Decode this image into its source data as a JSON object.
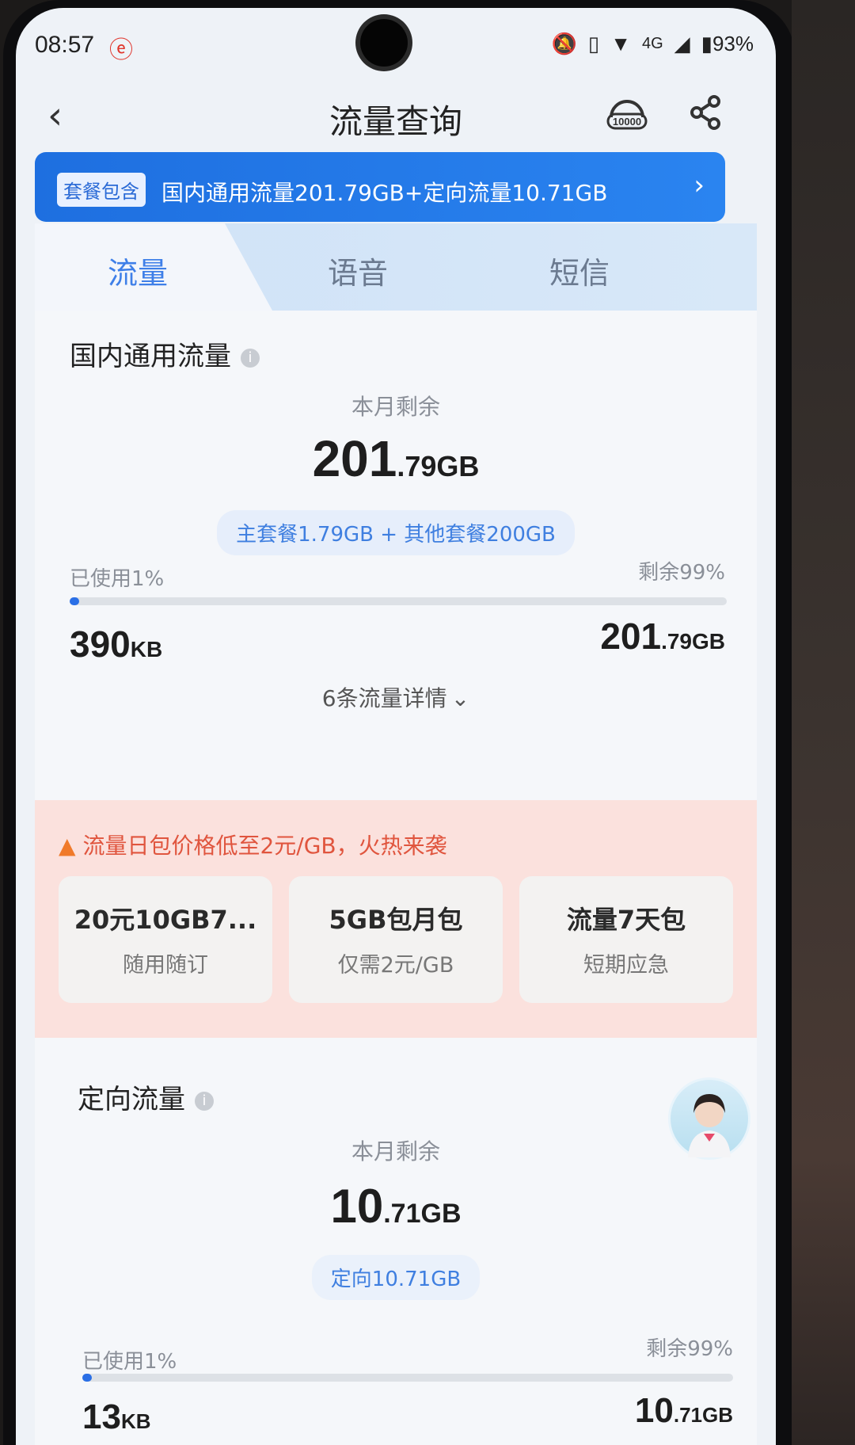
{
  "status_bar": {
    "time": "08:57",
    "network": "4G",
    "battery": "93%"
  },
  "header": {
    "title": "流量查询",
    "service_icon_text": "10000"
  },
  "banner": {
    "tag": "套餐包含",
    "text": "国内通用流量201.79GB+定向流量10.71GB"
  },
  "tabs": [
    {
      "label": "流量",
      "active": true
    },
    {
      "label": "语音",
      "active": false
    },
    {
      "label": "短信",
      "active": false
    }
  ],
  "domestic": {
    "title": "国内通用流量",
    "remaining_label": "本月剩余",
    "remaining_int": "201",
    "remaining_dec": ".79GB",
    "breakdown": "主套餐1.79GB + 其他套餐200GB",
    "used_label": "已使用1%",
    "left_label": "剩余99%",
    "used_fraction": 0.01,
    "used_value": "390",
    "used_unit": "KB",
    "left_int": "201",
    "left_dec": ".79GB",
    "details_link": "6条流量详情"
  },
  "promo": {
    "headline": "流量日包价格低至2元/GB，火热来袭",
    "items": [
      {
        "name": "20元10GB7...",
        "sub": "随用随订"
      },
      {
        "name": "5GB包月包",
        "sub": "仅需2元/GB"
      },
      {
        "name": "流量7天包",
        "sub": "短期应急"
      }
    ]
  },
  "directed": {
    "title": "定向流量",
    "remaining_label": "本月剩余",
    "remaining_int": "10",
    "remaining_dec": ".71GB",
    "breakdown": "定向10.71GB",
    "used_label": "已使用1%",
    "left_label": "剩余99%",
    "used_fraction": 0.01,
    "used_value": "13",
    "used_unit": "KB",
    "left_int": "10",
    "left_dec": ".71GB"
  },
  "colors": {
    "accent": "#2a6fe6",
    "banner": "#1e6fe0",
    "promo_text": "#e0553e"
  }
}
